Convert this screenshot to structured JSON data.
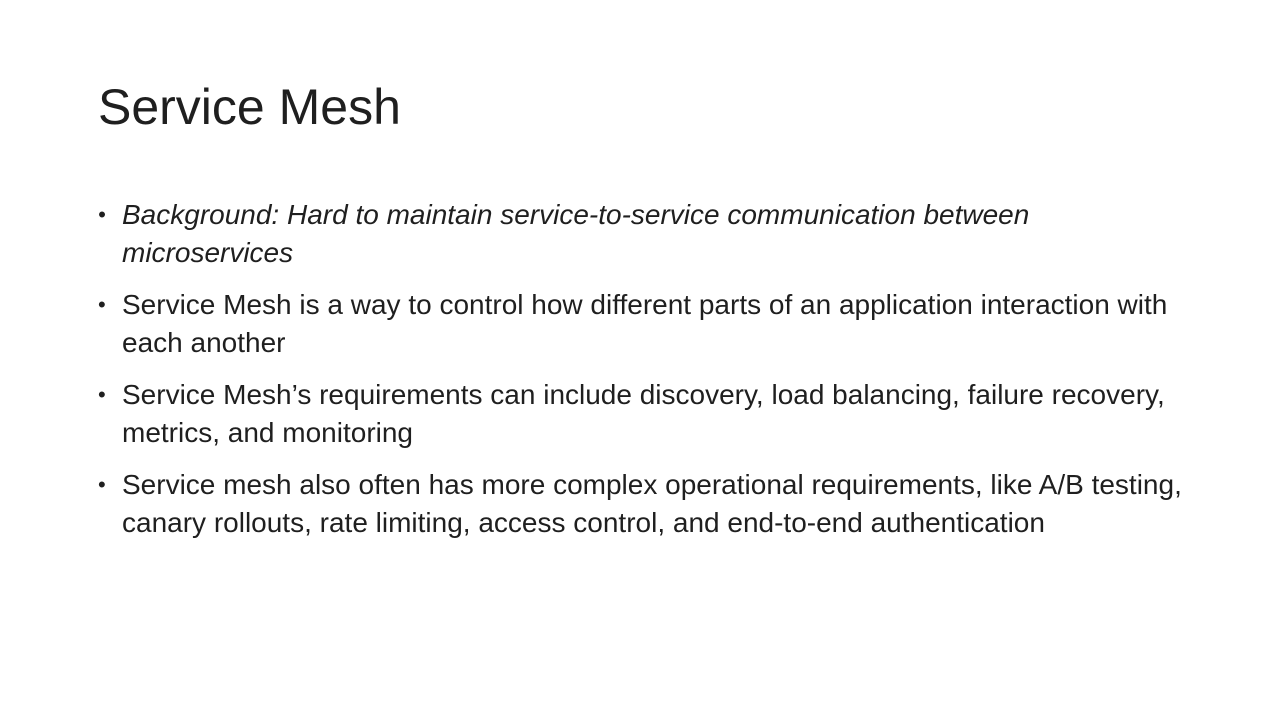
{
  "slide": {
    "title": "Service Mesh",
    "bullet_glyph": "•",
    "bullets": [
      {
        "text": "Background: Hard to maintain service-to-service communication between microservices",
        "italic": true
      },
      {
        "text": "Service Mesh is a way to control how different parts of an application interaction with each another",
        "italic": false
      },
      {
        "text": "Service Mesh’s requirements can include discovery, load balancing, failure recovery, metrics, and monitoring",
        "italic": false
      },
      {
        "text": "Service mesh also often has more complex operational requirements, like A/B testing, canary rollouts, rate limiting, access control, and end-to-end authentication",
        "italic": false
      }
    ]
  }
}
